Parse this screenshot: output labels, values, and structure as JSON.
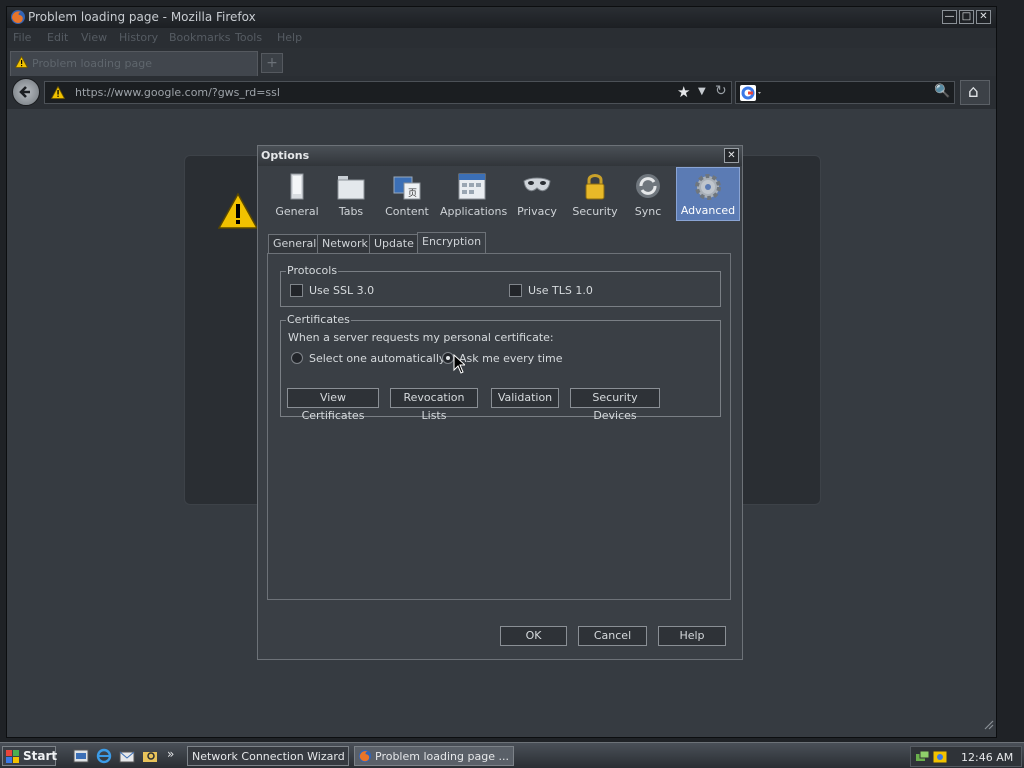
{
  "window": {
    "title": "Problem loading page - Mozilla Firefox",
    "min_glyph": "—",
    "max_glyph": "□",
    "close_glyph": "✕"
  },
  "menu": [
    "File",
    "Edit",
    "View",
    "History",
    "Bookmarks",
    "Tools",
    "Help"
  ],
  "tab": {
    "label": "Problem loading page",
    "new_tab_glyph": "+"
  },
  "nav": {
    "url": "https://www.google.com/?gws_rd=ssl",
    "star_glyph": "★",
    "dropdown_glyph": "▼",
    "reload_glyph": "↻",
    "search_glyph": "🔍",
    "home_glyph": "⌂"
  },
  "dialog": {
    "title": "Options",
    "close_glyph": "✕",
    "panes": [
      {
        "label": "General",
        "icon": "general-icon"
      },
      {
        "label": "Tabs",
        "icon": "tabs-icon"
      },
      {
        "label": "Content",
        "icon": "content-icon"
      },
      {
        "label": "Applications",
        "icon": "applications-icon"
      },
      {
        "label": "Privacy",
        "icon": "privacy-mask-icon"
      },
      {
        "label": "Security",
        "icon": "lock-icon"
      },
      {
        "label": "Sync",
        "icon": "sync-icon"
      },
      {
        "label": "Advanced",
        "icon": "gear-icon"
      }
    ],
    "selected_pane": "Advanced",
    "subtabs": [
      "General",
      "Network",
      "Update",
      "Encryption"
    ],
    "selected_subtab": "Encryption",
    "protocols": {
      "legend": "Protocols",
      "ssl_label": "Use SSL 3.0",
      "tls_label": "Use TLS 1.0",
      "ssl_checked": false,
      "tls_checked": false
    },
    "certificates": {
      "legend": "Certificates",
      "prompt": "When a server requests my personal certificate:",
      "radio_auto": "Select one automatically",
      "radio_ask": "Ask me every time",
      "selected": "radio_ask",
      "buttons": [
        "View Certificates",
        "Revocation Lists",
        "Validation",
        "Security Devices"
      ]
    },
    "footer": {
      "ok": "OK",
      "cancel": "Cancel",
      "help": "Help"
    }
  },
  "taskbar": {
    "start": "Start",
    "quicklaunch_more": "»",
    "tasks": [
      "Network Connection Wizard",
      "Problem loading page ..."
    ],
    "clock": "12:46 AM"
  },
  "colors": {
    "accent_selected": "#5b7bb4",
    "warning": "#f2c200"
  }
}
